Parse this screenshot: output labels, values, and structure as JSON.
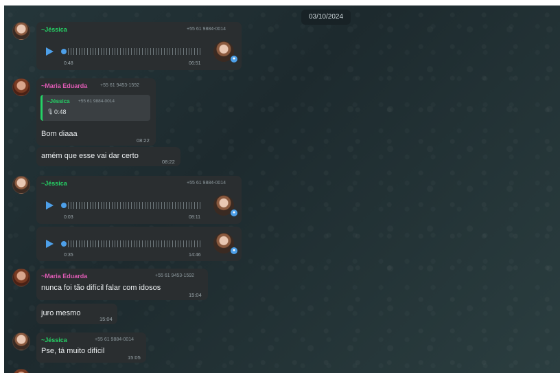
{
  "date_chip": "03/10/2024",
  "messages": [
    {
      "sender": "~Jéssica",
      "phone": "+55 61 9884-0014",
      "voice_elapsed": "0:48",
      "voice_time": "06:51"
    },
    {
      "sender": "~Maria Eduarda",
      "phone": "+55 61 9453-1592",
      "quote": {
        "sender": "~Jéssica",
        "phone": "+55 61 9884-0014",
        "duration": "0:48"
      },
      "text": "Bom diaaa",
      "time": "08:22"
    },
    {
      "text": "amém que esse vai dar certo",
      "time": "08:22"
    },
    {
      "sender": "~Jéssica",
      "phone": "+55 61 9884-0014",
      "voice_elapsed": "0:03",
      "voice_time": "08:11"
    },
    {
      "voice_elapsed": "0:35",
      "voice_time": "14:46"
    },
    {
      "sender": "~Maria Eduarda",
      "phone": "+55 61 9453-1592",
      "text": "nunca foi tão difícil falar com idosos",
      "time": "15:04"
    },
    {
      "text": "juro mesmo",
      "time": "15:04"
    },
    {
      "sender": "~Jéssica",
      "phone": "+55 61 9884-0014",
      "text": "Pse,  tá muito difícil",
      "time": "15:05"
    }
  ],
  "icons": {
    "play": "play-icon",
    "mic": "mic-icon",
    "avatar_jessica": "avatar",
    "avatar_maria": "avatar"
  },
  "colors": {
    "accent": "#4d9fe8",
    "jessica_name": "#25d366",
    "maria_name": "#e05bb5",
    "bubble": "#2a2e30"
  }
}
